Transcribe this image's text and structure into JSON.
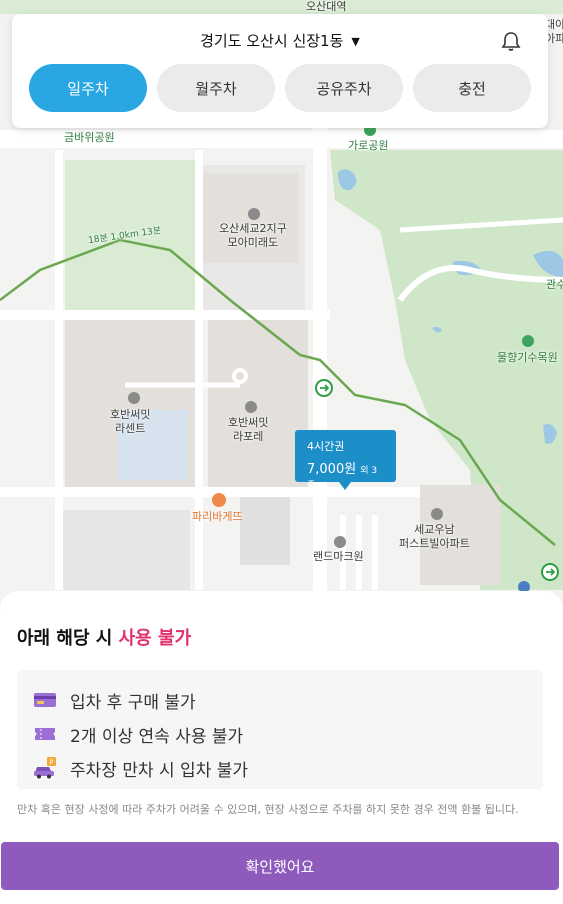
{
  "header": {
    "location": "경기도 오산시 신장1동",
    "tabs": [
      {
        "label": "일주차",
        "active": true
      },
      {
        "label": "월주차",
        "active": false
      },
      {
        "label": "공유주차",
        "active": false
      },
      {
        "label": "충전",
        "active": false
      }
    ]
  },
  "map": {
    "labels": {
      "top_station": "오산대역",
      "top_right": "대아\n아파",
      "park_geumba": "금바위공원",
      "park_garo": "가로공원",
      "school": "오산세교2지구\n모아미래도",
      "route": "18분 1.0km 13분",
      "apt_rasent": "호반써밋\n라센트",
      "apt_rapore": "호반써밋\n라포레",
      "bakery": "파리바게뜨",
      "landmark": "랜드마크원",
      "apt_sekyo": "세교우남\n퍼스트빌아파트",
      "arboretum": "물향기수목원",
      "right_edge": "관수"
    },
    "marker": {
      "ticket": "4시간권",
      "price": "7,000원",
      "extra": "외 3종"
    }
  },
  "sheet": {
    "title_prefix": "아래 해당 시",
    "title_warning": "사용 불가",
    "rules": [
      {
        "icon": "credit-card-icon",
        "text": "입차 후 구매 불가"
      },
      {
        "icon": "ticket-icon",
        "text": "2개 이상 연속 사용 불가"
      },
      {
        "icon": "car-parking-icon",
        "text": "주차장 만차 시 입차 불가"
      }
    ],
    "note": "만차 혹은 현장 사정에 따라 주차가 어려울 수 있으며, 현장 사정으로 주차를 하지 못한 경우 전액 환불 됩니다.",
    "confirm_label": "확인했어요"
  },
  "colors": {
    "accent_blue": "#2aa7e3",
    "marker_blue": "#1c8ec8",
    "warning_pink": "#e3306b",
    "confirm_purple": "#8e5bbd"
  }
}
